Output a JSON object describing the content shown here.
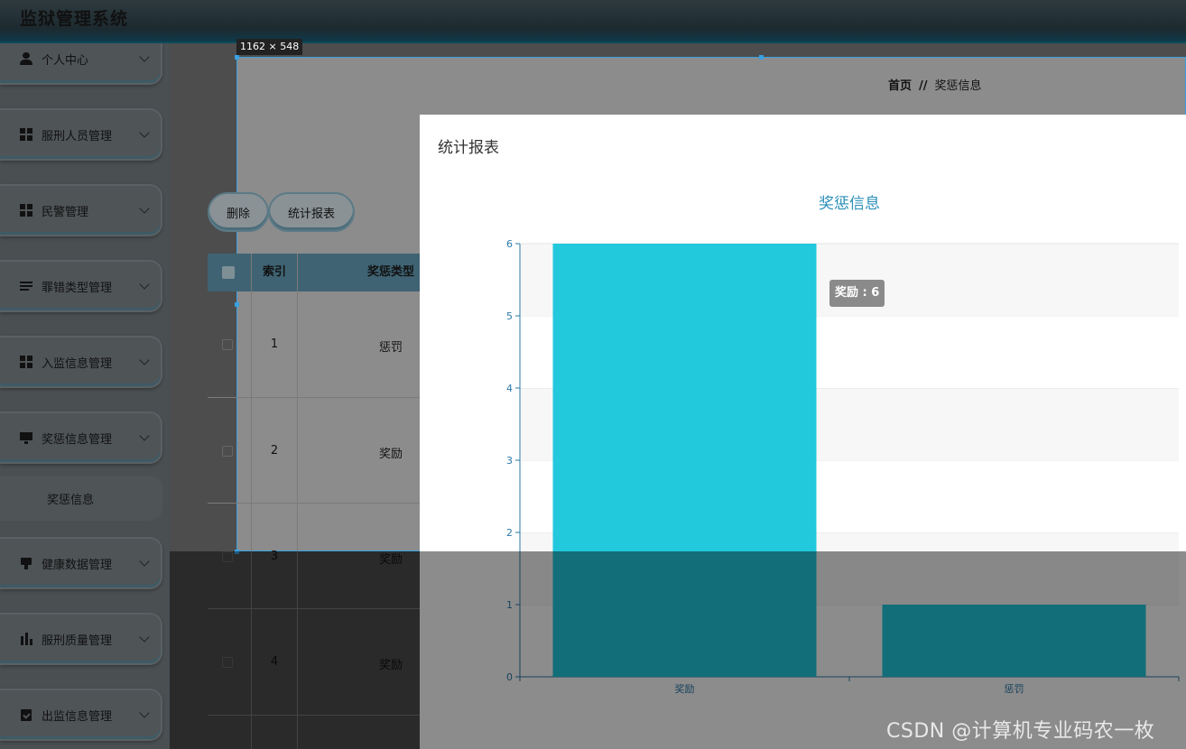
{
  "app": {
    "title": "监狱管理系统"
  },
  "sidebar": {
    "items": [
      {
        "label": "个人中心",
        "icon": "user-icon"
      },
      {
        "label": "服刑人员管理",
        "icon": "grid-icon"
      },
      {
        "label": "民警管理",
        "icon": "grid-icon"
      },
      {
        "label": "罪错类型管理",
        "icon": "list-icon"
      },
      {
        "label": "入监信息管理",
        "icon": "grid-icon"
      },
      {
        "label": "奖惩信息管理",
        "icon": "monitor-icon"
      },
      {
        "label": "健康数据管理",
        "icon": "bubble-icon"
      },
      {
        "label": "服刑质量管理",
        "icon": "bar-chart-icon"
      },
      {
        "label": "出监信息管理",
        "icon": "clipboard-check-icon"
      }
    ],
    "sub_item": "奖惩信息"
  },
  "screenshot_tool": {
    "size_label": "1162 × 548"
  },
  "breadcrumb": {
    "home": "首页",
    "separator": "//",
    "current": "奖惩信息"
  },
  "toolbar": {
    "delete_label": "删除",
    "stats_label": "统计报表"
  },
  "table": {
    "headers": {
      "index": "索引",
      "type": "奖惩类型"
    },
    "rows": [
      {
        "index": "1",
        "type": "惩罚"
      },
      {
        "index": "2",
        "type": "奖励"
      },
      {
        "index": "3",
        "type": "奖励"
      },
      {
        "index": "4",
        "type": "奖励"
      }
    ]
  },
  "modal": {
    "title": "统计报表"
  },
  "chart_data": {
    "type": "bar",
    "title": "奖惩信息",
    "categories": [
      "奖励",
      "惩罚"
    ],
    "values": [
      6,
      1
    ],
    "ylim": [
      0,
      6
    ],
    "yticks": [
      "0",
      "1",
      "2",
      "3",
      "4",
      "5",
      "6"
    ],
    "grid": true,
    "bar_color": "#22c8dc",
    "tooltip": "奖励 : 6"
  },
  "watermark": "CSDN @计算机专业码农一枚",
  "colors": {
    "accent": "#2a8fb7",
    "selection": "#3aa0e0"
  }
}
